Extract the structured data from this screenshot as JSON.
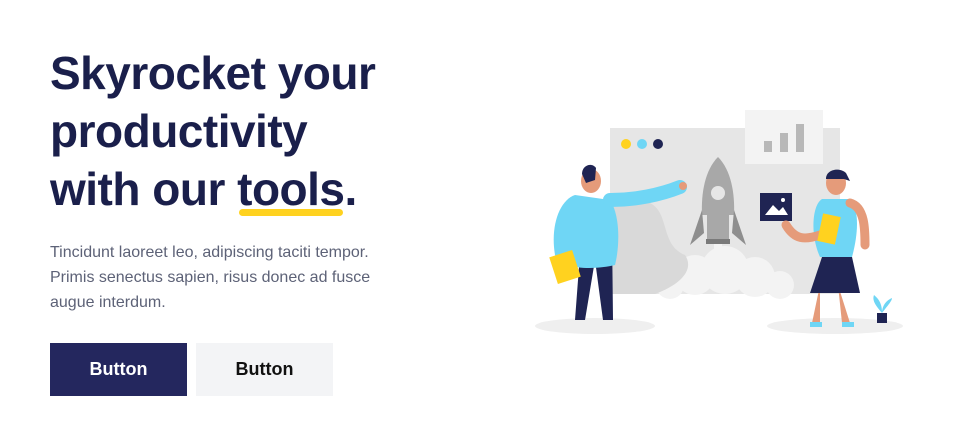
{
  "hero": {
    "headline_line1": "Skyrocket your",
    "headline_line2": "productivity",
    "headline_line3_prefix": "with our ",
    "headline_highlight": "tools",
    "headline_suffix": ".",
    "subtitle": "Tincidunt laoreet leo, adipiscing taciti tempor. Primis senectus sapien, risus donec ad fusce augue interdum."
  },
  "buttons": {
    "primary_label": "Button",
    "secondary_label": "Button"
  },
  "colors": {
    "heading": "#1a1f4b",
    "accent_yellow": "#ffd21f",
    "primary_button": "#24275e",
    "secondary_button": "#f3f4f6",
    "illustration_blue": "#6fd6f5"
  },
  "illustration": {
    "icon": "rocket-launch-illustration"
  }
}
